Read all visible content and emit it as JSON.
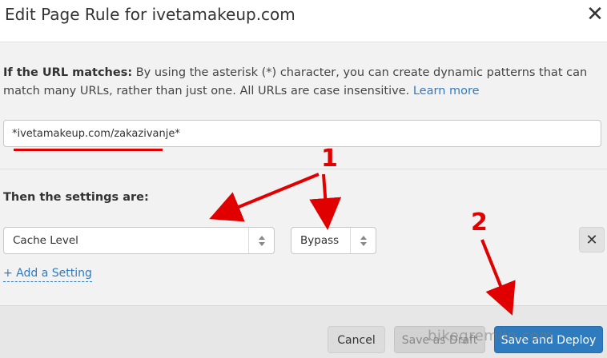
{
  "dialog": {
    "title": "Edit Page Rule for ivetamakeup.com"
  },
  "url_section": {
    "label": "If the URL matches:",
    "description": " By using the asterisk (*) character, you can create dynamic patterns that can match many URLs, rather than just one. All URLs are case insensitive. ",
    "learn_more": "Learn more",
    "url_value": "*ivetamakeup.com/zakazivanje*"
  },
  "settings": {
    "title": "Then the settings are:",
    "setting_name": "Cache Level",
    "setting_value": "Bypass",
    "remove_label": "✕",
    "add_setting": "+ Add a Setting"
  },
  "footer": {
    "cancel": "Cancel",
    "save_draft": "Save as Draft",
    "save_deploy": "Save and Deploy"
  },
  "annotations": {
    "marker_1": "1",
    "marker_2": "2",
    "color": "#e00000"
  },
  "watermark": "bikegremlin.com",
  "colors": {
    "accent": "#2f7bbf",
    "annotation": "#e00000",
    "panel_bg": "#f2f2f2",
    "footer_bg": "#e7e7e7"
  },
  "icons": {
    "close": "close-icon",
    "stepper": "updown-stepper-icon",
    "remove": "remove-x-icon"
  }
}
